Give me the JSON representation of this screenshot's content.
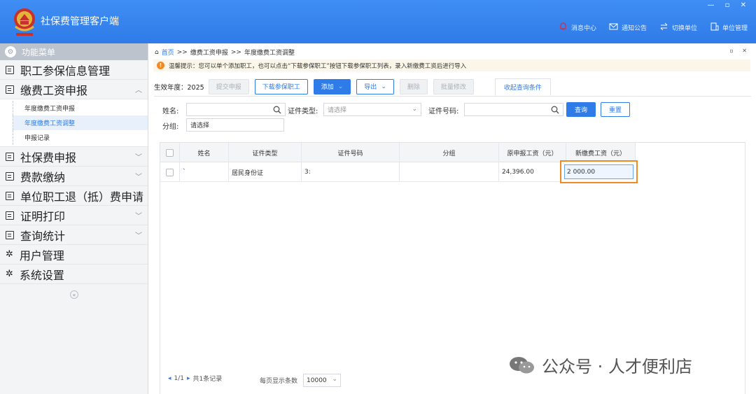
{
  "app": {
    "title": "社保费管理客户端",
    "window_controls": "— ▫ ✕"
  },
  "top_nav": [
    {
      "icon": "bell-icon",
      "label": "消息中心"
    },
    {
      "icon": "mail-icon",
      "label": "通知公告"
    },
    {
      "icon": "switch-icon",
      "label": "切换单位"
    },
    {
      "icon": "building-icon",
      "label": "单位管理"
    }
  ],
  "sidebar": {
    "header": "功能菜单",
    "menu": [
      {
        "label": "职工参保信息管理",
        "chevron": false
      },
      {
        "label": "缴费工资申报",
        "chevron": true,
        "expanded": true
      },
      {
        "label": "社保费申报",
        "chevron": true
      },
      {
        "label": "费款缴纳",
        "chevron": true
      },
      {
        "label": "单位职工退（抵）费申请",
        "chevron": false
      },
      {
        "label": "证明打印",
        "chevron": true
      },
      {
        "label": "查询统计",
        "chevron": true
      },
      {
        "label": "用户管理",
        "chevron": false
      },
      {
        "label": "系统设置",
        "chevron": false
      }
    ],
    "submenu": [
      {
        "label": "年度缴费工资申报",
        "active": false
      },
      {
        "label": "年度缴费工资调整",
        "active": true
      },
      {
        "label": "申报记录",
        "active": false
      }
    ],
    "collapse_label": "«"
  },
  "breadcrumb": {
    "home": "首页",
    "sep": ">>",
    "level1": "缴费工资申报",
    "level2": "年度缴费工资调整"
  },
  "panel_controls": "▫ ✕",
  "tip": {
    "text": "温馨提示：您可以单个添加职工，也可以点击“下载参保职工”按钮下载参保职工列表，录入新缴费工资后进行导入"
  },
  "toolbar": {
    "year_label": "生效年度：",
    "year_value": "2025",
    "submit": "提交申报",
    "download": "下载参保职工",
    "add": "添加",
    "export": "导出",
    "delete": "删除",
    "batch_edit": "批量修改",
    "collapse_query": "收起查询条件"
  },
  "search": {
    "name_label": "姓名:",
    "name_value": "",
    "id_type_label": "证件类型:",
    "id_type_placeholder": "请选择",
    "id_no_label": "证件号码:",
    "id_no_value": "",
    "query": "查询",
    "reset": "重置",
    "group_label": "分组:",
    "group_value": "请选择"
  },
  "table": {
    "columns": [
      "姓名",
      "证件类型",
      "证件号码",
      "分组",
      "原申报工资（元）",
      "新缴费工资（元）"
    ],
    "rows": [
      {
        "name": "`",
        "id_type": "居民身份证",
        "id_no": "3:",
        "group": "",
        "old_salary": "24,396.00",
        "new_salary": "2  000.00"
      }
    ]
  },
  "pager": {
    "page": "1/1",
    "total": "共1条记录",
    "size_label": "每页显示条数",
    "size_value": "10000"
  },
  "watermark": "公众号 · 人才便利店",
  "colors": {
    "brand_blue": "#2f7be8",
    "highlight_orange": "#f08a24"
  }
}
